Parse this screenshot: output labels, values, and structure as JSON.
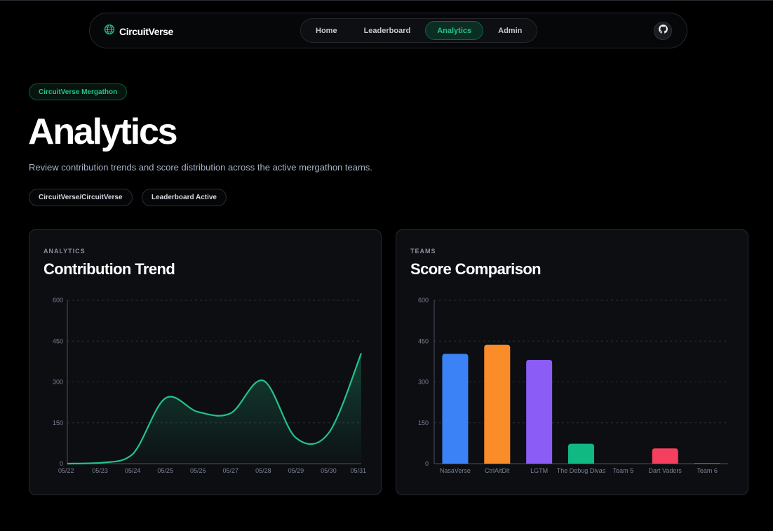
{
  "nav": {
    "brand": "CircuitVerse",
    "links": [
      "Home",
      "Leaderboard",
      "Analytics",
      "Admin"
    ],
    "active_link": "Analytics",
    "github_icon": "github-icon"
  },
  "header": {
    "event_badge": "CircuitVerse Mergathon",
    "title": "Analytics",
    "subtitle": "Review contribution trends and score distribution across the active mergathon teams.",
    "chips": [
      "CircuitVerse/CircuitVerse",
      "Leaderboard Active"
    ]
  },
  "colors": {
    "accent": "#22c38a",
    "background": "#000000",
    "card": "#0d0e12"
  },
  "cards": {
    "trend": {
      "kicker": "ANALYTICS",
      "title": "Contribution Trend"
    },
    "scores": {
      "kicker": "TEAMS",
      "title": "Score Comparison"
    }
  },
  "chart_data": [
    {
      "type": "area",
      "x": [
        "05/22",
        "05/23",
        "05/24",
        "05/25",
        "05/26",
        "05/27",
        "05/28",
        "05/29",
        "05/30",
        "05/31"
      ],
      "values": [
        0,
        3,
        35,
        240,
        190,
        185,
        305,
        95,
        112,
        405
      ],
      "ylim": [
        0,
        600
      ],
      "yticks": [
        0,
        150,
        300,
        450,
        600
      ],
      "grid": true,
      "color": "#22c38a"
    },
    {
      "type": "bar",
      "categories": [
        "NasaVerse",
        "CtrlAltDlt",
        "LGTM",
        "The Debug Divas",
        "Team 5",
        "Dart Vaders",
        "Team 6"
      ],
      "values": [
        403,
        436,
        381,
        73,
        0,
        56,
        2
      ],
      "colors": [
        "#3b82f6",
        "#fb8c2a",
        "#8b5cf6",
        "#10b981",
        "#3b82f6",
        "#f43f5e",
        "#3b82f6"
      ],
      "ylim": [
        0,
        600
      ],
      "yticks": [
        0,
        150,
        300,
        450,
        600
      ],
      "grid": true
    }
  ]
}
